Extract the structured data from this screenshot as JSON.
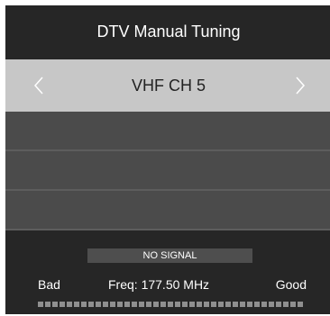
{
  "header": {
    "title": "DTV Manual Tuning"
  },
  "channel": {
    "value": "VHF CH 5",
    "left_icon": "chevron-left-icon",
    "right_icon": "chevron-right-icon"
  },
  "status": {
    "text": "NO SIGNAL"
  },
  "signal": {
    "bad_label": "Bad",
    "freq_label": "Freq: 177.50 MHz",
    "good_label": "Good",
    "strength_level": 0
  },
  "colors": {
    "panel": "#262626",
    "selected_row": "#c7c7c7",
    "empty_row": "#4b4b4b",
    "meter_segment": "#8f8f8f"
  }
}
